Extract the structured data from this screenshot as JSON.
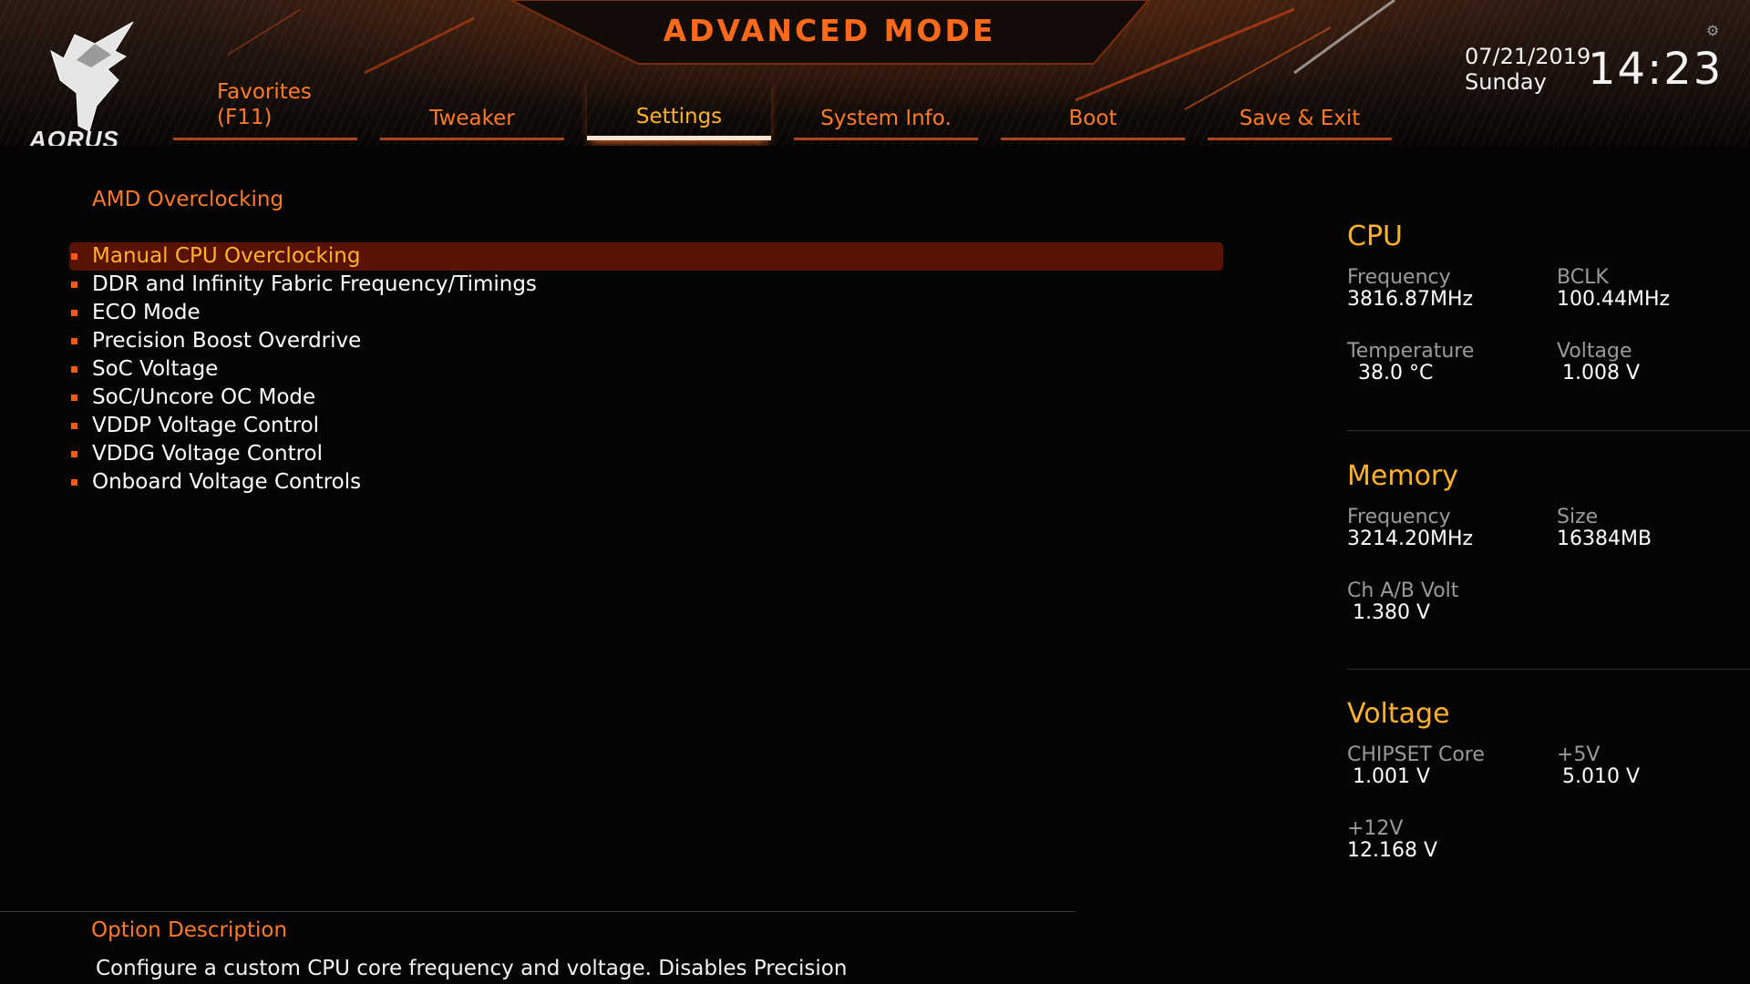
{
  "header": {
    "logo_text": "AORUS",
    "title": "ADVANCED MODE",
    "date": "07/21/2019",
    "day": "Sunday",
    "time": "14:23",
    "accent_color": "#ff6a1a"
  },
  "tabs": [
    {
      "label": "Favorites\n(F11)",
      "active": false
    },
    {
      "label": "Tweaker",
      "active": false
    },
    {
      "label": "Settings",
      "active": true
    },
    {
      "label": "System Info.",
      "active": false
    },
    {
      "label": "Boot",
      "active": false
    },
    {
      "label": "Save & Exit",
      "active": false
    }
  ],
  "main": {
    "section_title": "AMD Overclocking",
    "items": [
      {
        "label": "Manual CPU Overclocking",
        "selected": true
      },
      {
        "label": "DDR and Infinity Fabric Frequency/Timings"
      },
      {
        "label": "ECO Mode"
      },
      {
        "label": "Precision Boost Overdrive"
      },
      {
        "label": "SoC Voltage"
      },
      {
        "label": "SoC/Uncore OC Mode"
      },
      {
        "label": "VDDP Voltage Control"
      },
      {
        "label": "VDDG Voltage Control"
      },
      {
        "label": "Onboard Voltage Controls"
      }
    ]
  },
  "panel": {
    "cpu": {
      "title": "CPU",
      "frequency_label": "Frequency",
      "frequency": "3816.87MHz",
      "bclk_label": "BCLK",
      "bclk": "100.44MHz",
      "temperature_label": "Temperature",
      "temperature": "38.0 °C",
      "voltage_label": "Voltage",
      "voltage": "1.008 V"
    },
    "memory": {
      "title": "Memory",
      "frequency_label": "Frequency",
      "frequency": "3214.20MHz",
      "size_label": "Size",
      "size": "16384MB",
      "chab_label": "Ch A/B Volt",
      "chab": "1.380 V"
    },
    "voltage": {
      "title": "Voltage",
      "chipset_label": "CHIPSET Core",
      "chipset": "1.001 V",
      "p5v_label": "+5V",
      "p5v": "5.010 V",
      "p12v_label": "+12V",
      "p12v": "12.168 V"
    }
  },
  "footer": {
    "title": "Option Description",
    "text": "Configure a custom CPU core frequency and voltage. Disables Precision"
  }
}
